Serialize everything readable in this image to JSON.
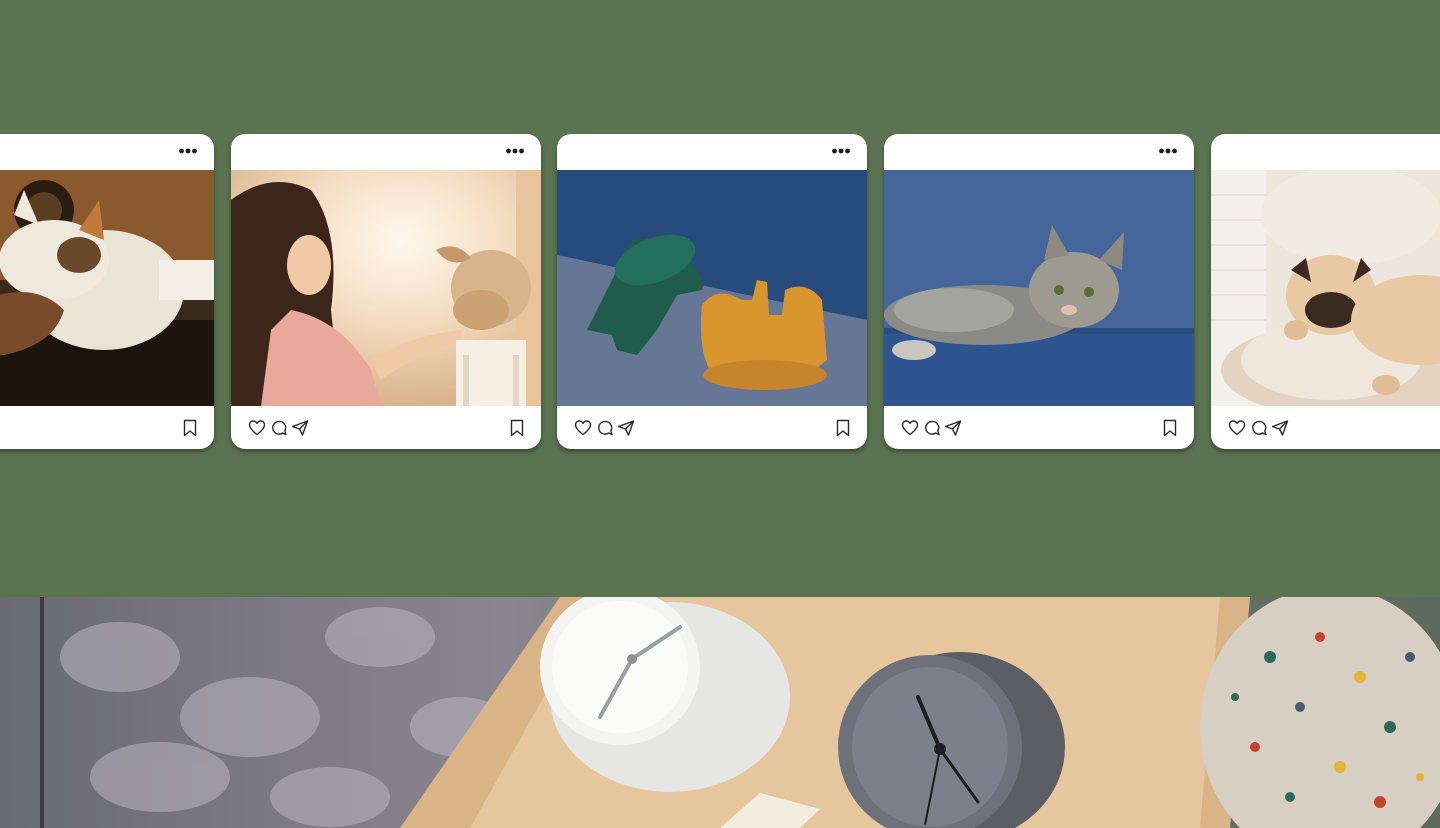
{
  "feed": {
    "posts": [
      {
        "id": "post-1",
        "photo": "cat-being-petted",
        "icons": {
          "more": "more-horizontal-icon",
          "like": "heart-icon",
          "comment": "comment-icon",
          "share": "send-icon",
          "save": "bookmark-icon"
        }
      },
      {
        "id": "post-2",
        "photo": "girl-with-puppy"
      },
      {
        "id": "post-3",
        "photo": "wooden-objects"
      },
      {
        "id": "post-4",
        "photo": "tabby-cat-on-sofa"
      },
      {
        "id": "post-5",
        "photo": "pug-on-blanket"
      }
    ]
  },
  "background": {
    "color": "#5a7350",
    "bottom_photo": "desk-clocks-in-tray"
  }
}
